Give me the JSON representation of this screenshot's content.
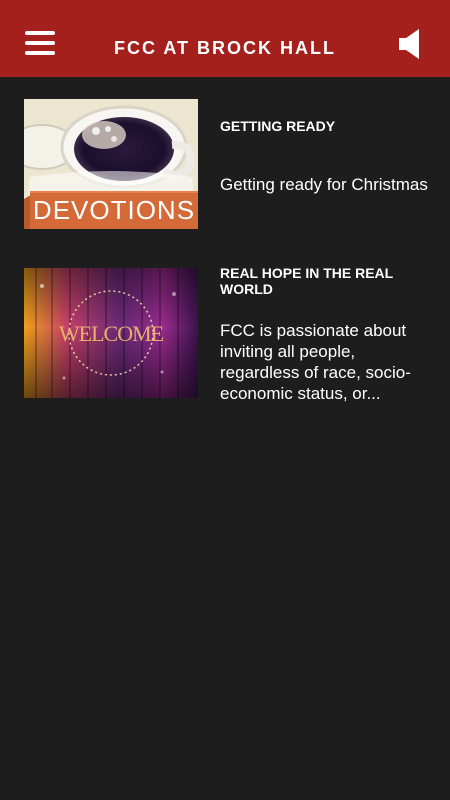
{
  "header": {
    "title": "FCC AT BROCK HALL",
    "menu_icon": "hamburger-menu-icon",
    "sound_icon": "speaker-icon"
  },
  "feed": {
    "items": [
      {
        "title": "GETTING READY",
        "description": "Getting ready for Christmas",
        "thumbnail_text": "DEVOTIONS"
      },
      {
        "title": "REAL HOPE IN THE REAL WORLD",
        "description": "FCC is passionate about inviting all people, regardless of race, socio-economic status, or...",
        "thumbnail_text": "WELCOME"
      }
    ]
  },
  "colors": {
    "header_bg": "#a3201d",
    "page_bg": "#1d1d1d",
    "text": "#ffffff",
    "devotions_banner": "#d46a38"
  }
}
